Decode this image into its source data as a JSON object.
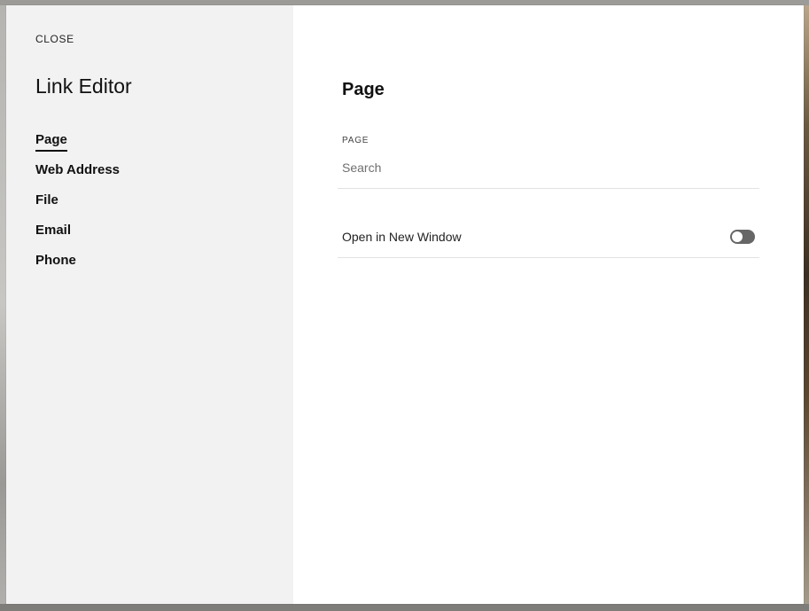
{
  "close_label": "CLOSE",
  "sidebar": {
    "title": "Link Editor",
    "items": [
      {
        "label": "Page",
        "active": true
      },
      {
        "label": "Web Address",
        "active": false
      },
      {
        "label": "File",
        "active": false
      },
      {
        "label": "Email",
        "active": false
      },
      {
        "label": "Phone",
        "active": false
      }
    ]
  },
  "main": {
    "title": "Page",
    "page_field": {
      "label": "PAGE",
      "placeholder": "Search",
      "value": ""
    },
    "open_new_window": {
      "label": "Open in New Window",
      "checked": false
    }
  },
  "colors": {
    "sidebar_bg": "#f2f2f2",
    "main_bg": "#ffffff",
    "toggle_off": "#666666"
  }
}
